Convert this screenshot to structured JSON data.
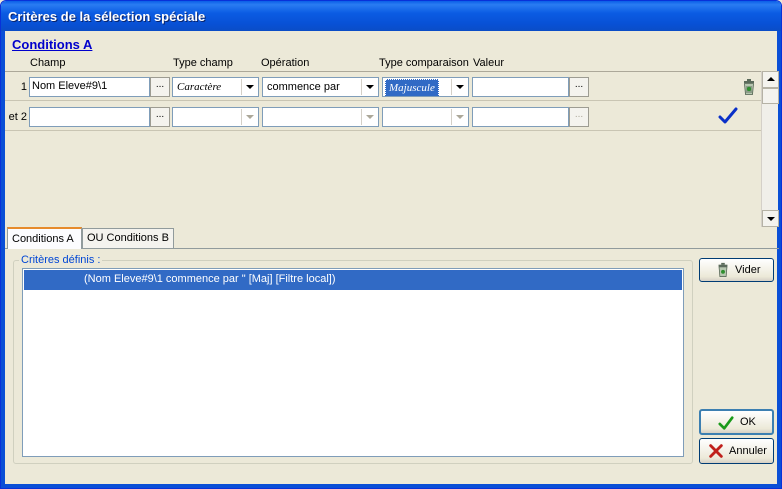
{
  "window": {
    "title": "Critères de la sélection spéciale"
  },
  "section_title": "Conditions A",
  "columns": {
    "champ": "Champ",
    "type_champ": "Type champ",
    "operation": "Opération",
    "type_comparaison": "Type comparaison",
    "valeur": "Valeur"
  },
  "rows": [
    {
      "num": "1",
      "champ": "Nom Eleve#9\\1",
      "ellipsis": "...",
      "type_champ": "Caractère",
      "operation": "commence par",
      "type_comparaison": "Majuscule",
      "valeur": "",
      "action_icon": "trash-icon"
    },
    {
      "num": "et 2",
      "champ": "",
      "ellipsis": "...",
      "type_champ": "",
      "operation": "",
      "type_comparaison": "",
      "valeur": "",
      "action_icon": "checkmark-icon"
    }
  ],
  "tabs": [
    {
      "label": "Conditions A",
      "active": true
    },
    {
      "label": "OU Conditions B",
      "active": false
    }
  ],
  "criteres": {
    "legend": "Critères définis :",
    "items": [
      "(Nom Eleve#9\\1 commence par \" [Maj] [Filtre local])"
    ]
  },
  "buttons": {
    "vider": "Vider",
    "ok": "OK",
    "annuler": "Annuler"
  },
  "colors": {
    "titlebar": "#0a5ee8",
    "selection": "#316ac5",
    "link": "#0000cc",
    "ok_green": "#1a9a1a",
    "cancel_red": "#c0201b",
    "check_blue": "#0a30c8"
  }
}
